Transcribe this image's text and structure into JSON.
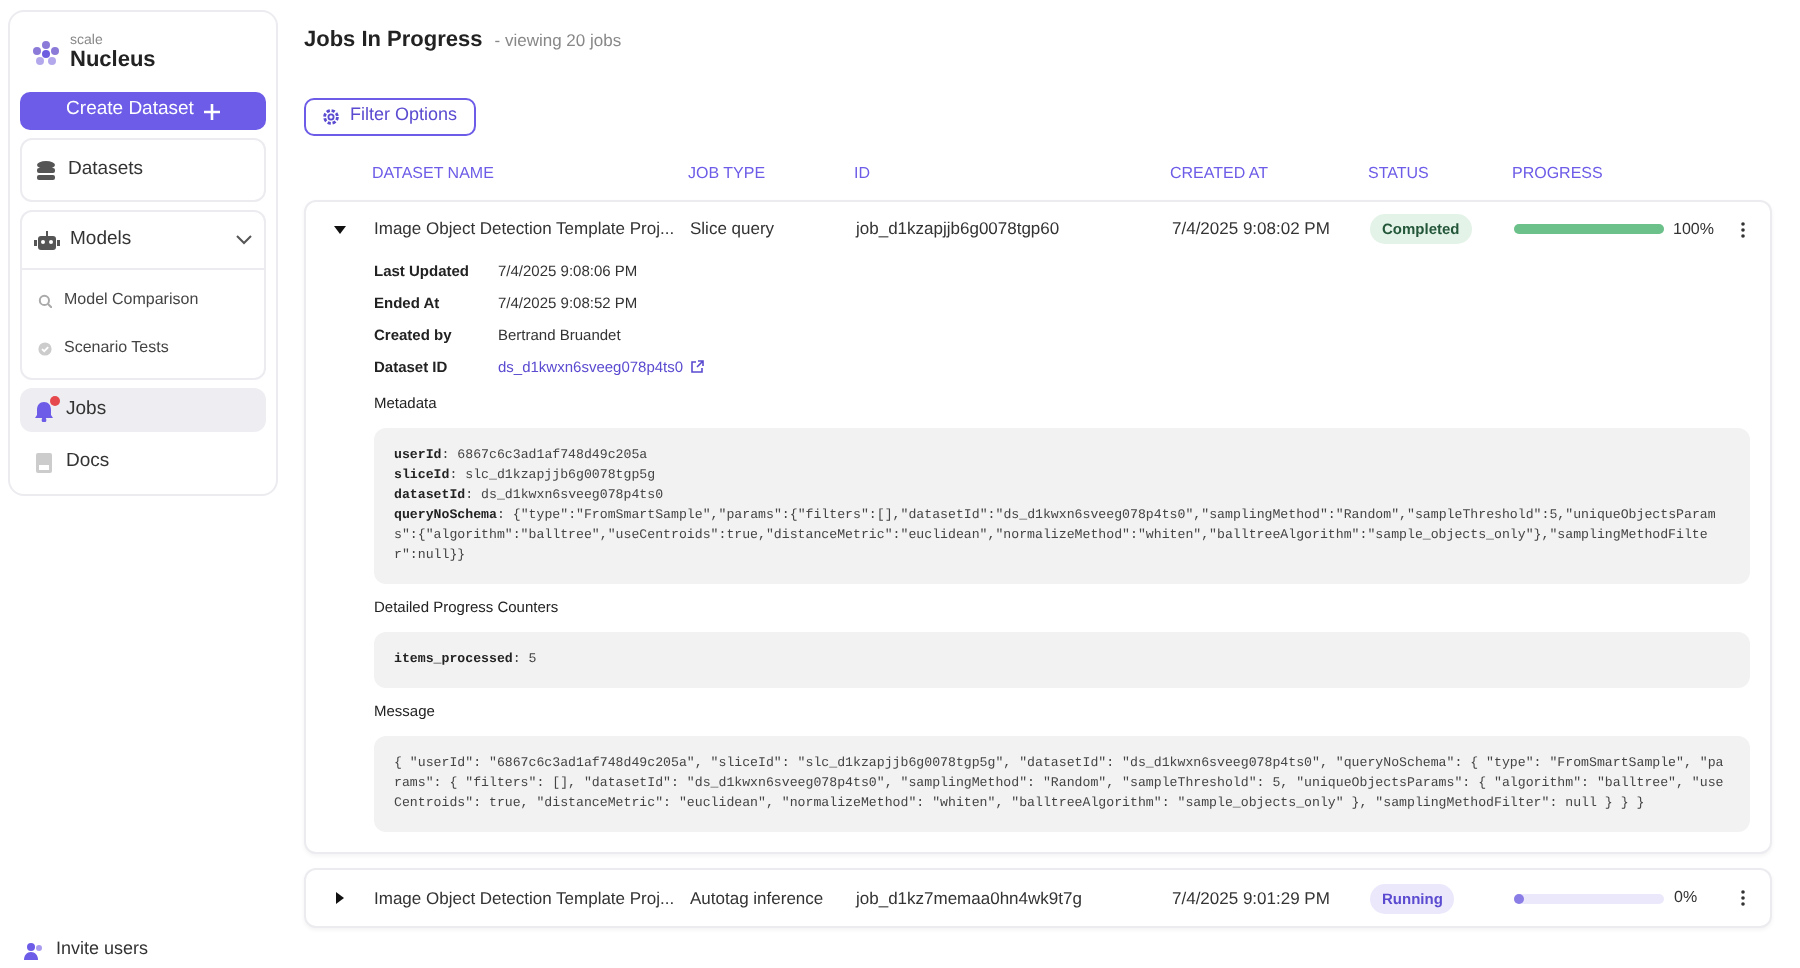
{
  "sidebar": {
    "brand": {
      "small": "scale",
      "name": "Nucleus"
    },
    "create_button": "Create Dataset",
    "nav": [
      {
        "kind": "card",
        "label": "Datasets"
      },
      {
        "kind": "group",
        "label": "Models",
        "expanded": true,
        "children": [
          {
            "label": "Model Comparison"
          },
          {
            "label": "Scenario Tests"
          }
        ]
      },
      {
        "kind": "link",
        "label": "Jobs",
        "selected": true,
        "notification": true
      },
      {
        "kind": "link",
        "label": "Docs",
        "selected": false
      }
    ],
    "footer": "Invite users"
  },
  "main": {
    "title": "Jobs In Progress",
    "subtitle": "- viewing 20 jobs",
    "filter_button": "Filter Options",
    "columns": [
      "DATASET NAME",
      "JOB TYPE",
      "ID",
      "CREATED AT",
      "STATUS",
      "PROGRESS"
    ],
    "jobs": [
      {
        "expanded": true,
        "name": "Image Object Detection Template Proj...",
        "job_type": "Slice query",
        "id": "job_d1kzapjjb6g0078tgp60",
        "created_at": "7/4/2025 9:08:02 PM",
        "status": {
          "kind": "completed",
          "label": "Completed"
        },
        "level": 1,
        "progress": "100%",
        "details": {
          "fields": [
            {
              "label": "Last Updated",
              "value": "7/4/2025 9:08:06 PM",
              "kind": "text"
            },
            {
              "label": "Ended At",
              "value": "7/4/2025 9:08:52 PM",
              "kind": "text"
            },
            {
              "label": "Created by",
              "value": "Bertrand Bruandet",
              "kind": "text"
            },
            {
              "label": "Dataset ID",
              "value": "ds_d1kwxn6sveeg078p4ts0",
              "kind": "link"
            }
          ],
          "sections": [
            {
              "label": "Metadata",
              "kind": "lines",
              "lines": [
                "**userId**: 6867c6c3ad1af748d49c205a",
                "**sliceId**: slc_d1kzapjjb6g0078tgp5g",
                "**datasetId**: ds_d1kwxn6sveeg078p4ts0",
                "**queryNoSchema**: {\"type\":\"FromSmartSample\",\"params\":{\"filters\":[],\"datasetId\":\"ds_d1kwxn6sveeg078p4ts0\",\"samplingMethod\":\"Random\",\"sampleThreshold\":5,\"uniqueObjectsParams\":{\"algorithm\":\"balltree\",\"useCentroids\":true,\"distanceMetric\":\"euclidean\",\"normalizeMethod\":\"whiten\",\"balltreeAlgorithm\":\"sample_objects_only\"},\"samplingMethodFilter\":null}}"
              ]
            },
            {
              "label": "Detailed Progress Counters",
              "kind": "lines",
              "lines": [
                "**items_processed**: 5"
              ]
            },
            {
              "label": "Message",
              "kind": "text",
              "text": "{ \"userId\": \"6867c6c3ad1af748d49c205a\", \"sliceId\": \"slc_d1kzapjjb6g0078tgp5g\", \"datasetId\": \"ds_d1kwxn6sveeg078p4ts0\", \"queryNoSchema\": { \"type\": \"FromSmartSample\", \"params\": { \"filters\": [], \"datasetId\": \"ds_d1kwxn6sveeg078p4ts0\", \"samplingMethod\": \"Random\", \"sampleThreshold\": 5, \"uniqueObjectsParams\": { \"algorithm\": \"balltree\", \"useCentroids\": true, \"distanceMetric\": \"euclidean\", \"normalizeMethod\": \"whiten\", \"balltreeAlgorithm\": \"sample_objects_only\" }, \"samplingMethodFilter\": null } } }"
            }
          ]
        }
      },
      {
        "expanded": false,
        "name": "Image Object Detection Template Proj...",
        "job_type": "Autotag inference",
        "id": "job_d1kz7memaa0hn4wk9t7g",
        "created_at": "7/4/2025 9:01:29 PM",
        "status": {
          "kind": "running",
          "label": "Running"
        },
        "level": 0,
        "progress": "0%"
      }
    ]
  }
}
